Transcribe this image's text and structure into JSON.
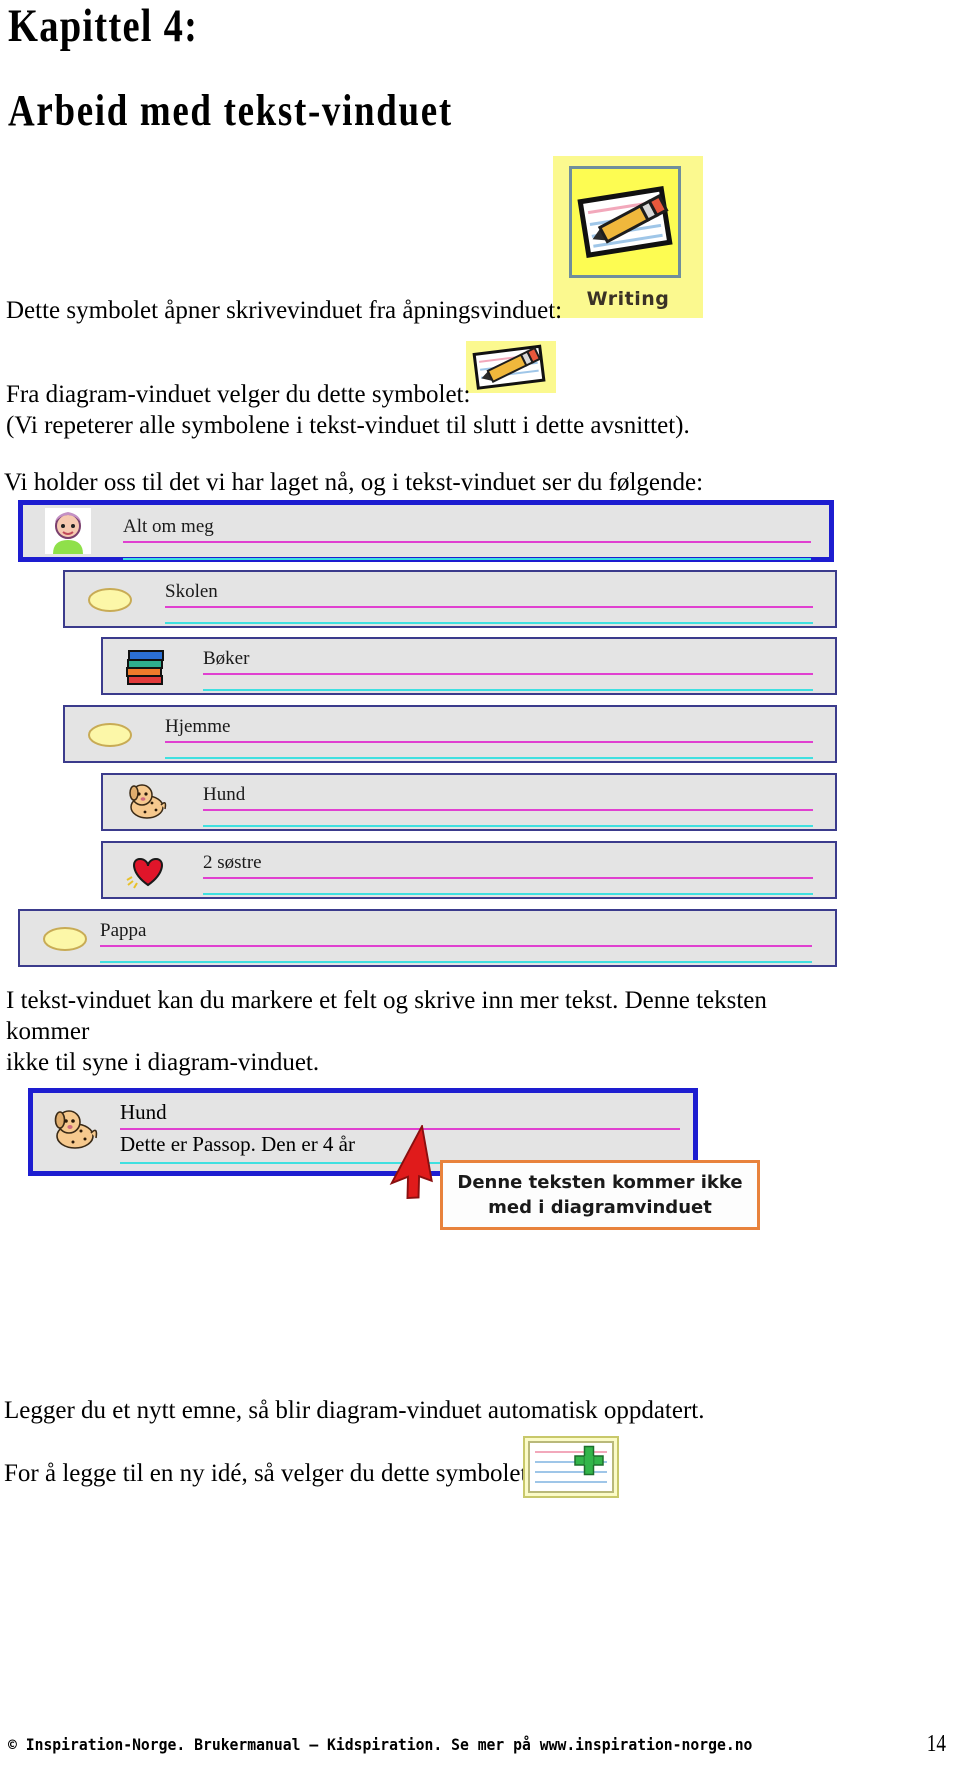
{
  "document": {
    "chapter_label": "Kapittel 4:",
    "chapter_title": "Arbeid med tekst-vinduet"
  },
  "paragraphs": {
    "dette_symbolet": "Dette symbolet åpner skrivevinduet fra åpningsvinduet:",
    "fra_diagram": "Fra diagram-vinduet velger du dette symbolet:",
    "vi_repeterer": "(Vi repeterer alle symbolene i tekst-vinduet til slutt i dette avsnittet).",
    "vi_holder": "Vi holder oss til det vi har laget nå, og i tekst-vinduet ser du følgende:",
    "markere_line1": "I tekst-vinduet kan du markere et felt og skrive inn mer tekst. Denne teksten kommer",
    "markere_line2": "ikke til syne i diagram-vinduet.",
    "legger_du": "Legger du et nytt emne, så blir diagram-vinduet automatisk oppdatert.",
    "for_a_legge": "For å legge til en ny idé, så velger du dette symbolet:"
  },
  "writing_palette": {
    "caption": "Writing",
    "icon": "paper-pencil-icon",
    "bg_color": "#fbf98f",
    "tile_color": "#fdfc52",
    "border_color": "#6f8e9c"
  },
  "symbols": {
    "paper_pencil": "paper-pencil-icon",
    "new_idea_plus": "plus-icon",
    "plus_color": "#33b54a"
  },
  "outline_window": {
    "selection_color": "#1d1dd0",
    "row_bg": "#e4e4e4",
    "rule_pink": "#e040d0",
    "rule_cyan": "#3fe0e0",
    "rows": [
      {
        "label": "Alt om meg",
        "icon": "girl-face-icon",
        "level": 0,
        "selected": true
      },
      {
        "label": "Skolen",
        "icon": "yellow-oval-icon",
        "level": 1,
        "selected": false
      },
      {
        "label": "Bøker",
        "icon": "book-stack-icon",
        "level": 2,
        "selected": false
      },
      {
        "label": "Hjemme",
        "icon": "yellow-oval-icon",
        "level": 1,
        "selected": false
      },
      {
        "label": "Hund",
        "icon": "dog-icon",
        "level": 2,
        "selected": false
      },
      {
        "label": "2 søstre",
        "icon": "heart-icon",
        "level": 2,
        "selected": false
      },
      {
        "label": "Pappa",
        "icon": "yellow-oval-icon",
        "level": 0,
        "selected": false
      }
    ]
  },
  "text_edit_shot": {
    "title": "Hund",
    "body": "Dette er Passop. Den er 4 år",
    "icon": "dog-icon",
    "arrow": "red-arrow-icon"
  },
  "callout": {
    "line1": "Denne teksten kommer ikke",
    "line2": "med i diagramvinduet",
    "border_color": "#e8823c"
  },
  "footer": {
    "text": "© Inspiration-Norge. Brukermanual – Kidspiration. Se mer på www.inspiration-norge.no",
    "page_number": "14"
  }
}
